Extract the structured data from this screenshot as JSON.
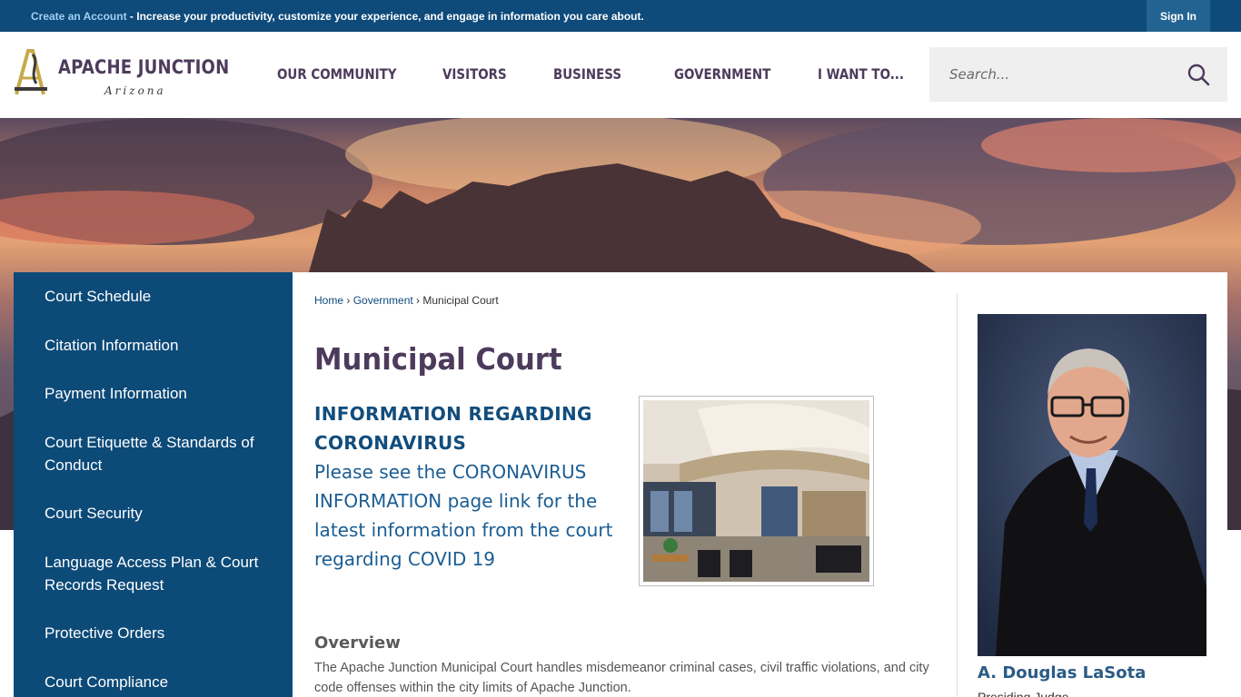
{
  "topbar": {
    "promo_link": "Create an Account",
    "promo_text": " - Increase your productivity, customize your experience, and engage in information you care about.",
    "sign_in": "Sign In"
  },
  "logo": {
    "name": "APACHE JUNCTION",
    "state": "Arizona"
  },
  "nav": [
    "OUR COMMUNITY",
    "VISITORS",
    "BUSINESS",
    "GOVERNMENT",
    "I WANT TO..."
  ],
  "search": {
    "placeholder": "Search..."
  },
  "sidebar": {
    "items": [
      "Court Schedule",
      "Citation Information",
      "Payment Information",
      "Court Etiquette & Standards of Conduct",
      "Court Security",
      "Language Access Plan & Court Records Request",
      "Protective Orders",
      "Court Compliance"
    ]
  },
  "breadcrumb": {
    "home": "Home",
    "section": "Government",
    "current": "Municipal Court",
    "sep": " › "
  },
  "main": {
    "title": "Municipal Court",
    "notice_heading": "INFORMATION REGARDING CORONAVIRUS",
    "notice_body": "Please see the CORONAVIRUS INFORMATION page link for the latest information from the court regarding COVID 19",
    "overview_heading": "Overview",
    "overview_text": "The Apache Junction Municipal Court handles misdemeanor criminal cases, civil traffic violations, and city code offenses within the city limits of Apache Junction."
  },
  "judge": {
    "name": "A. Douglas LaSota",
    "role": "Presiding Judge"
  },
  "icons": {
    "search": "search-icon",
    "logo": "logo-mark-icon"
  },
  "colors": {
    "primary": "#0e4a7a",
    "sidebar": "#0c4a78",
    "accent": "#4d3b5c",
    "link": "#124d7c"
  }
}
